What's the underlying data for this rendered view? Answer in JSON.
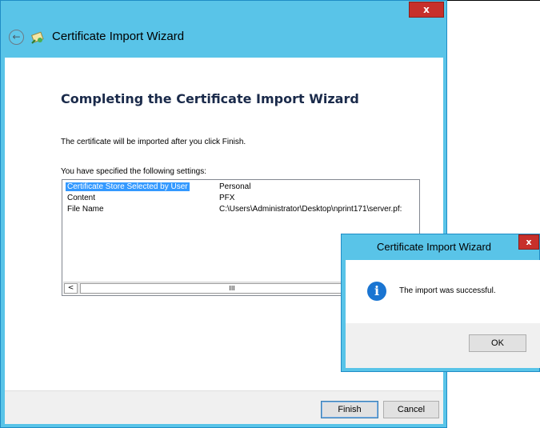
{
  "wizard": {
    "title": "Certificate Import Wizard",
    "close_glyph": "x",
    "back_glyph": "←",
    "heading": "Completing the Certificate Import Wizard",
    "description": "The certificate will be imported after you click Finish.",
    "settings_label": "You have specified the following settings:",
    "settings": [
      {
        "key": "Certificate Store Selected by User",
        "value": "Personal"
      },
      {
        "key": "Content",
        "value": "PFX"
      },
      {
        "key": "File Name",
        "value": "C:\\Users\\Administrator\\Desktop\\nprint171\\server.pf:"
      }
    ],
    "scroll_left_glyph": "<",
    "scroll_thumb_glyph": "III",
    "finish_label": "Finish",
    "cancel_label": "Cancel"
  },
  "message_box": {
    "title": "Certificate Import Wizard",
    "close_glyph": "x",
    "icon_glyph": "i",
    "text": "The import was successful.",
    "ok_label": "OK"
  },
  "colors": {
    "window_frame": "#59c4e8",
    "close_button": "#c7302b",
    "selection": "#3399ff",
    "info_icon": "#1a75d2"
  }
}
